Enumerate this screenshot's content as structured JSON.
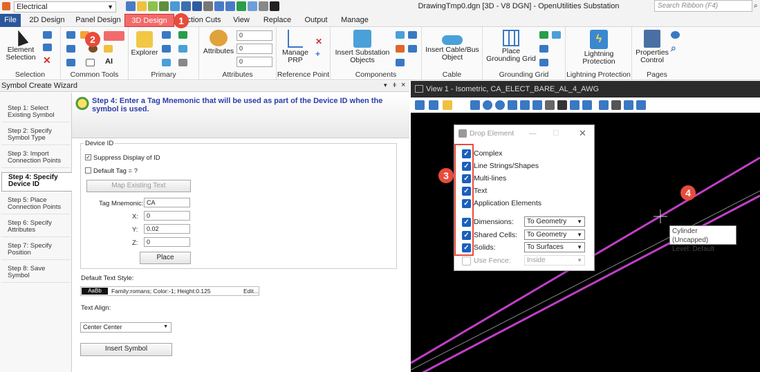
{
  "app": {
    "workspace": "Electrical",
    "window_title": "DrawingTmp0.dgn [3D - V8 DGN] - OpenUtilities Substation",
    "search_placeholder": "Search Ribbon (F4)"
  },
  "tabs": [
    "File",
    "2D Design",
    "Panel Design",
    "3D Design",
    "ection Cuts",
    "View",
    "Replace",
    "Output",
    "Manage"
  ],
  "ribbon": {
    "groups": [
      "Selection",
      "Common Tools",
      "Primary",
      "Attributes",
      "Reference Point",
      "Components",
      "Cable",
      "Grounding Grid",
      "Lightning Protection",
      "Pages"
    ],
    "buttons": {
      "element_selection": "Element Selection",
      "explorer": "Explorer",
      "attributes": "Attributes",
      "manage_prp": "Manage PRP",
      "insert_substation": "Insert Substation Objects",
      "insert_cable": "Insert Cable/Bus Object",
      "place_grounding": "Place Grounding Grid",
      "lightning": "Lightning Protection",
      "properties": "Properties Control"
    },
    "attr_values": [
      "0",
      "0",
      "0"
    ]
  },
  "wizard": {
    "title": "Symbol Create Wizard",
    "steps": [
      "Step 1: Select Existing Symbol",
      "Step 2: Specify Symbol Type",
      "Step 3: Import Connection Points",
      "Step 4: Specify Device ID",
      "Step 5: Place Connection Points",
      "Step 6: Specify Attributes",
      "Step 7: Specify Position",
      "Step 8: Save Symbol"
    ],
    "step_header": "Step 4: Enter a Tag Mnemonic that will be used as part of the Device ID when the symbol is used.",
    "device_id_label": "Device ID",
    "suppress_label": "Suppress Display of ID",
    "suppress_checked": true,
    "default_tag_label": "Default Tag = ?",
    "default_tag_checked": false,
    "map_button": "Map Existing Text",
    "tag_label": "Tag Mnemonic:",
    "tag_value": "CA",
    "x_label": "X:",
    "x_value": "0",
    "y_label": "Y:",
    "y_value": "0.02",
    "z_label": "Z:",
    "z_value": "0",
    "place_button": "Place",
    "text_style_label": "Default Text Style:",
    "text_style_sample": "AaBb",
    "text_style_value": "Family:romans; Color:-1; Height:0.125",
    "edit_label": "Edit...",
    "text_align_label": "Text Align:",
    "text_align_value": "Center Center",
    "insert_button": "Insert Symbol"
  },
  "view": {
    "title": "View 1 - Isometric, CA_ELECT_BARE_AL_4_AWG",
    "tooltip_line1": "Cylinder (Uncapped)",
    "tooltip_line2": "Level: Default"
  },
  "drop_element": {
    "title": "Drop Element",
    "items": [
      {
        "label": "Complex",
        "checked": true
      },
      {
        "label": "Line Strings/Shapes",
        "checked": true
      },
      {
        "label": "Multi-lines",
        "checked": true
      },
      {
        "label": "Text",
        "checked": true
      },
      {
        "label": "Application Elements",
        "checked": true
      },
      {
        "label": "Dimensions:",
        "checked": true,
        "option": "To Geometry"
      },
      {
        "label": "Shared Cells:",
        "checked": true,
        "option": "To Geometry"
      },
      {
        "label": "Solids:",
        "checked": true,
        "option": "To Surfaces"
      },
      {
        "label": "Use Fence:",
        "checked": false,
        "option": "Inside"
      }
    ]
  },
  "callouts": [
    "1",
    "2",
    "3",
    "4"
  ],
  "colors": {
    "accent": "#f26b6b",
    "file_tab": "#2b579a",
    "callout": "#e74c3c",
    "line": "#c13fc7",
    "check": "#1a5fbf"
  }
}
